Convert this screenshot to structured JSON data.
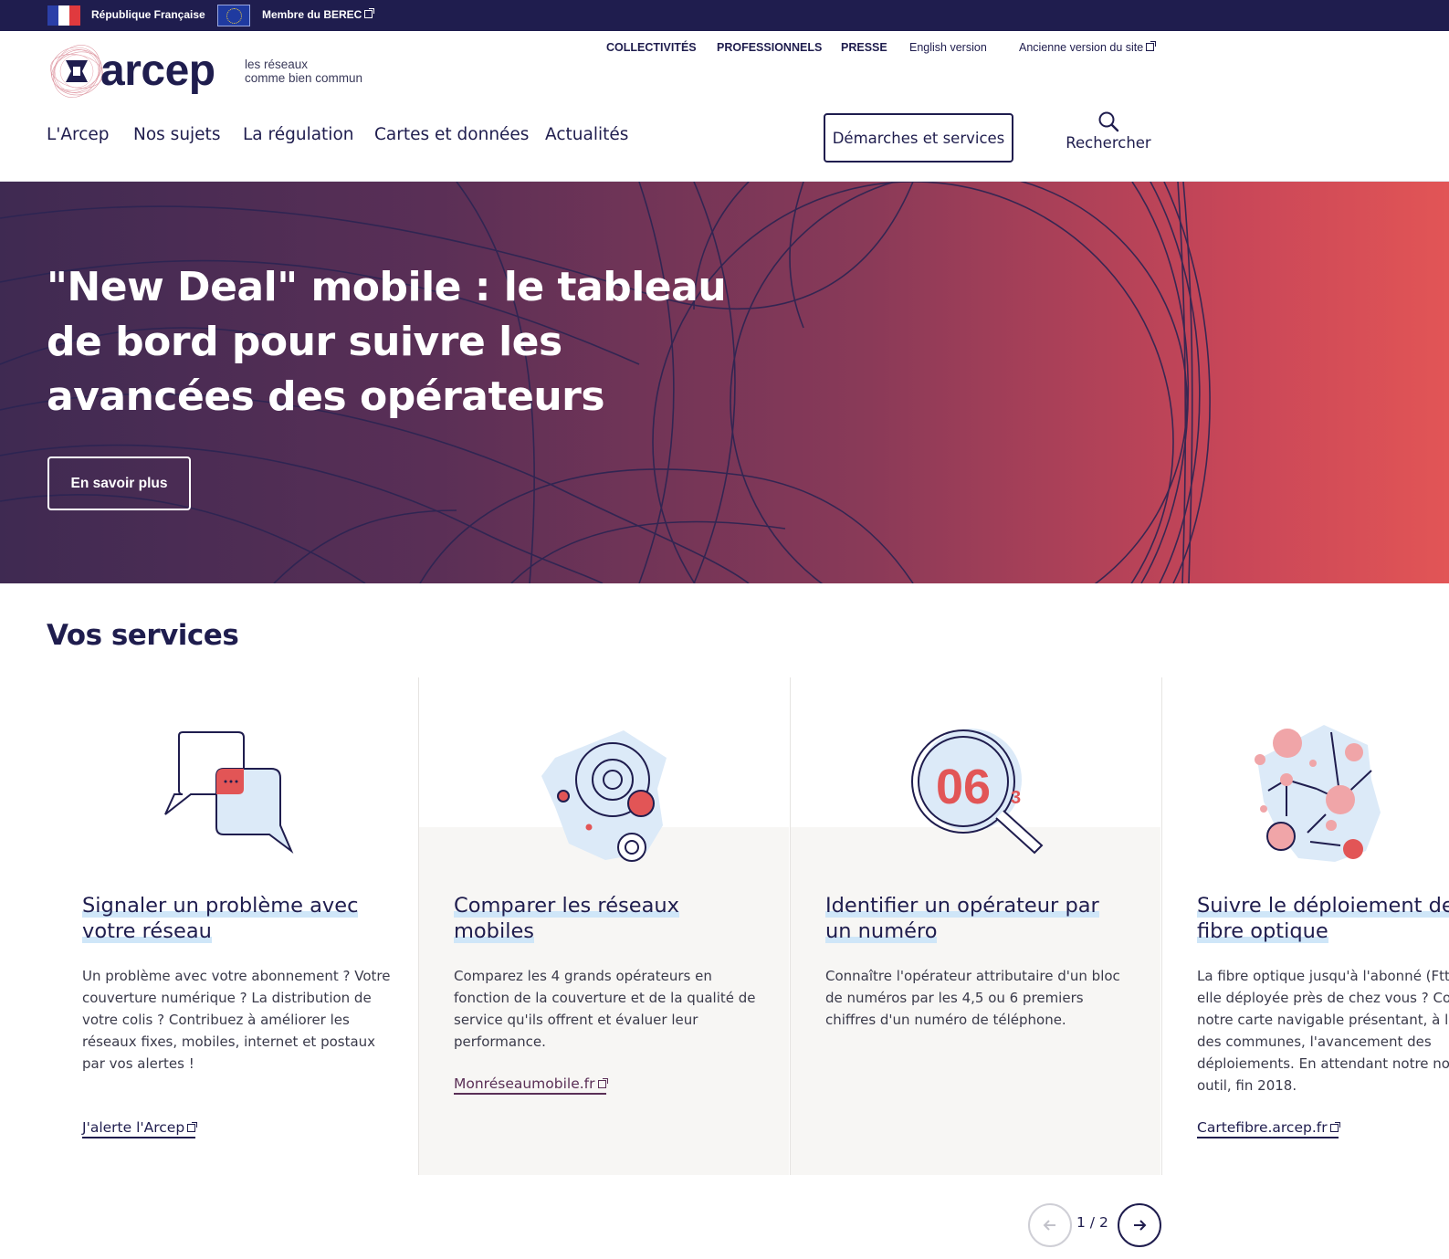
{
  "topbar": {
    "republique": "République Française",
    "berec": "Membre du BEREC"
  },
  "brand": {
    "name": "arcep",
    "tagline_line1": "les réseaux",
    "tagline_line2": "comme bien commun"
  },
  "utility_nav": [
    {
      "label": "COLLECTIVITÉS"
    },
    {
      "label": "PROFESSIONNELS"
    },
    {
      "label": "PRESSE"
    },
    {
      "label": "English version"
    },
    {
      "label": "Ancienne version du site"
    }
  ],
  "main_nav": [
    {
      "label": "L'Arcep"
    },
    {
      "label": "Nos sujets"
    },
    {
      "label": "La régulation"
    },
    {
      "label": "Cartes et données"
    },
    {
      "label": "Actualités"
    }
  ],
  "demarches_label": "Démarches et services",
  "search_label": "Rechercher",
  "hero": {
    "title": "\"New Deal\" mobile : le tableau de bord pour suivre les avancées des opérateurs",
    "button": "En savoir plus"
  },
  "services": {
    "title": "Vos services",
    "cards": [
      {
        "title": "Signaler un problème avec votre réseau",
        "description": "Un problème avec votre abonnement ? Votre couverture numérique ? La distribution de votre colis ? Contribuez à améliorer les réseaux fixes, mobiles, internet et postaux par vos alertes !",
        "link": "J'alerte l'Arcep",
        "icon": "chat-bubbles-icon"
      },
      {
        "title": "Comparer les réseaux mobiles",
        "description": "Comparez les 4 grands opérateurs en fonction de la couverture et de la qualité de service qu'ils offrent et évaluer leur performance.",
        "link": "Monréseaumobile.fr",
        "icon": "france-map-signal-icon"
      },
      {
        "title": "Identifier un opérateur par un numéro",
        "description": "Connaître l'opérateur attributaire d'un bloc de numéros par les 4,5 ou 6 premiers chiffres d'un numéro de téléphone.",
        "link": "",
        "icon": "magnifier-number-icon",
        "icon_text": "06",
        "icon_small": "3"
      },
      {
        "title": "Suivre le déploiement de la fibre optique",
        "description": "La fibre optique jusqu'à l'abonné (FttH) est-elle déployée près de chez vous ? Consultez notre carte navigable présentant, à l'échelle des communes, l'avancement des déploiements. En attendant notre nouvel outil, fin 2018.",
        "link": "Cartefibre.arcep.fr",
        "icon": "network-map-icon"
      }
    ]
  },
  "pager": {
    "text": "1 / 2"
  },
  "colors": {
    "navy": "#1f1d4e",
    "coral": "#e25556",
    "light_blue": "#cfe6f8"
  }
}
